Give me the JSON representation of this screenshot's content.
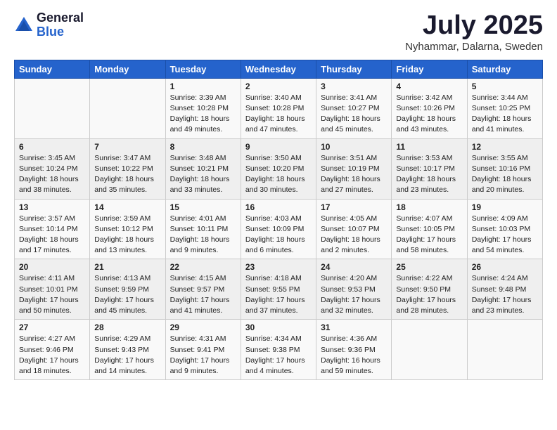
{
  "header": {
    "logo_general": "General",
    "logo_blue": "Blue",
    "month_title": "July 2025",
    "location": "Nyhammar, Dalarna, Sweden"
  },
  "days_of_week": [
    "Sunday",
    "Monday",
    "Tuesday",
    "Wednesday",
    "Thursday",
    "Friday",
    "Saturday"
  ],
  "weeks": [
    [
      {
        "day": "",
        "content": ""
      },
      {
        "day": "",
        "content": ""
      },
      {
        "day": "1",
        "content": "Sunrise: 3:39 AM\nSunset: 10:28 PM\nDaylight: 18 hours\nand 49 minutes."
      },
      {
        "day": "2",
        "content": "Sunrise: 3:40 AM\nSunset: 10:28 PM\nDaylight: 18 hours\nand 47 minutes."
      },
      {
        "day": "3",
        "content": "Sunrise: 3:41 AM\nSunset: 10:27 PM\nDaylight: 18 hours\nand 45 minutes."
      },
      {
        "day": "4",
        "content": "Sunrise: 3:42 AM\nSunset: 10:26 PM\nDaylight: 18 hours\nand 43 minutes."
      },
      {
        "day": "5",
        "content": "Sunrise: 3:44 AM\nSunset: 10:25 PM\nDaylight: 18 hours\nand 41 minutes."
      }
    ],
    [
      {
        "day": "6",
        "content": "Sunrise: 3:45 AM\nSunset: 10:24 PM\nDaylight: 18 hours\nand 38 minutes."
      },
      {
        "day": "7",
        "content": "Sunrise: 3:47 AM\nSunset: 10:22 PM\nDaylight: 18 hours\nand 35 minutes."
      },
      {
        "day": "8",
        "content": "Sunrise: 3:48 AM\nSunset: 10:21 PM\nDaylight: 18 hours\nand 33 minutes."
      },
      {
        "day": "9",
        "content": "Sunrise: 3:50 AM\nSunset: 10:20 PM\nDaylight: 18 hours\nand 30 minutes."
      },
      {
        "day": "10",
        "content": "Sunrise: 3:51 AM\nSunset: 10:19 PM\nDaylight: 18 hours\nand 27 minutes."
      },
      {
        "day": "11",
        "content": "Sunrise: 3:53 AM\nSunset: 10:17 PM\nDaylight: 18 hours\nand 23 minutes."
      },
      {
        "day": "12",
        "content": "Sunrise: 3:55 AM\nSunset: 10:16 PM\nDaylight: 18 hours\nand 20 minutes."
      }
    ],
    [
      {
        "day": "13",
        "content": "Sunrise: 3:57 AM\nSunset: 10:14 PM\nDaylight: 18 hours\nand 17 minutes."
      },
      {
        "day": "14",
        "content": "Sunrise: 3:59 AM\nSunset: 10:12 PM\nDaylight: 18 hours\nand 13 minutes."
      },
      {
        "day": "15",
        "content": "Sunrise: 4:01 AM\nSunset: 10:11 PM\nDaylight: 18 hours\nand 9 minutes."
      },
      {
        "day": "16",
        "content": "Sunrise: 4:03 AM\nSunset: 10:09 PM\nDaylight: 18 hours\nand 6 minutes."
      },
      {
        "day": "17",
        "content": "Sunrise: 4:05 AM\nSunset: 10:07 PM\nDaylight: 18 hours\nand 2 minutes."
      },
      {
        "day": "18",
        "content": "Sunrise: 4:07 AM\nSunset: 10:05 PM\nDaylight: 17 hours\nand 58 minutes."
      },
      {
        "day": "19",
        "content": "Sunrise: 4:09 AM\nSunset: 10:03 PM\nDaylight: 17 hours\nand 54 minutes."
      }
    ],
    [
      {
        "day": "20",
        "content": "Sunrise: 4:11 AM\nSunset: 10:01 PM\nDaylight: 17 hours\nand 50 minutes."
      },
      {
        "day": "21",
        "content": "Sunrise: 4:13 AM\nSunset: 9:59 PM\nDaylight: 17 hours\nand 45 minutes."
      },
      {
        "day": "22",
        "content": "Sunrise: 4:15 AM\nSunset: 9:57 PM\nDaylight: 17 hours\nand 41 minutes."
      },
      {
        "day": "23",
        "content": "Sunrise: 4:18 AM\nSunset: 9:55 PM\nDaylight: 17 hours\nand 37 minutes."
      },
      {
        "day": "24",
        "content": "Sunrise: 4:20 AM\nSunset: 9:53 PM\nDaylight: 17 hours\nand 32 minutes."
      },
      {
        "day": "25",
        "content": "Sunrise: 4:22 AM\nSunset: 9:50 PM\nDaylight: 17 hours\nand 28 minutes."
      },
      {
        "day": "26",
        "content": "Sunrise: 4:24 AM\nSunset: 9:48 PM\nDaylight: 17 hours\nand 23 minutes."
      }
    ],
    [
      {
        "day": "27",
        "content": "Sunrise: 4:27 AM\nSunset: 9:46 PM\nDaylight: 17 hours\nand 18 minutes."
      },
      {
        "day": "28",
        "content": "Sunrise: 4:29 AM\nSunset: 9:43 PM\nDaylight: 17 hours\nand 14 minutes."
      },
      {
        "day": "29",
        "content": "Sunrise: 4:31 AM\nSunset: 9:41 PM\nDaylight: 17 hours\nand 9 minutes."
      },
      {
        "day": "30",
        "content": "Sunrise: 4:34 AM\nSunset: 9:38 PM\nDaylight: 17 hours\nand 4 minutes."
      },
      {
        "day": "31",
        "content": "Sunrise: 4:36 AM\nSunset: 9:36 PM\nDaylight: 16 hours\nand 59 minutes."
      },
      {
        "day": "",
        "content": ""
      },
      {
        "day": "",
        "content": ""
      }
    ]
  ]
}
